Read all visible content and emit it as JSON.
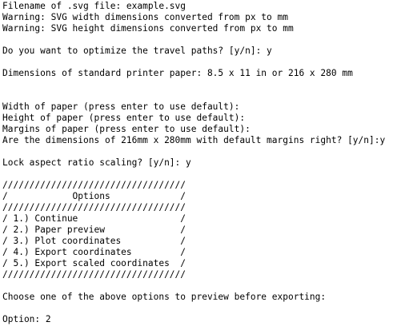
{
  "terminal": {
    "lines": [
      "Filename of .svg file: example.svg",
      "Warning: SVG width dimensions converted from px to mm",
      "Warning: SVG height dimensions converted from px to mm",
      "",
      "Do you want to optimize the travel paths? [y/n]: y",
      "",
      "Dimensions of standard printer paper: 8.5 x 11 in or 216 x 280 mm",
      "",
      "",
      "Width of paper (press enter to use default):",
      "Height of paper (press enter to use default):",
      "Margins of paper (press enter to use default):",
      "Are the dimensions of 216mm x 280mm with default margins right? [y/n]:y",
      "",
      "Lock aspect ratio scaling? [y/n]: y",
      "",
      "//////////////////////////////////",
      "/            Options             /",
      "//////////////////////////////////",
      "/ 1.) Continue                   /",
      "/ 2.) Paper preview              /",
      "/ 3.) Plot coordinates           /",
      "/ 4.) Export coordinates         /",
      "/ 5.) Export scaled coordinates  /",
      "//////////////////////////////////",
      "",
      "Choose one of the above options to preview before exporting:",
      "",
      "Option: 2"
    ]
  }
}
